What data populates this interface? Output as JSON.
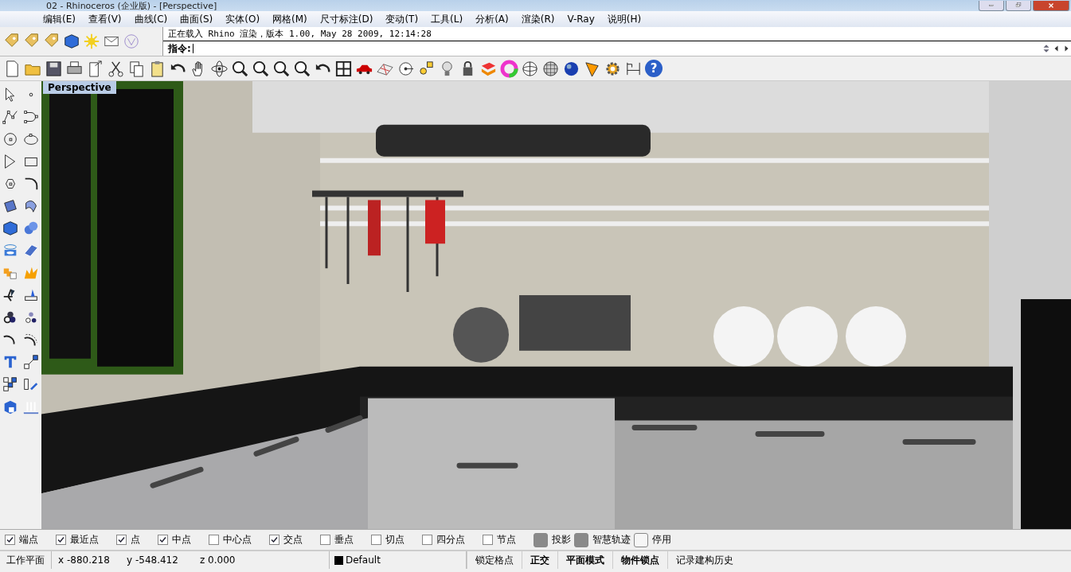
{
  "window": {
    "title": "02 - Rhinoceros (企业版) - [Perspective]"
  },
  "menu": [
    "编辑(E)",
    "查看(V)",
    "曲线(C)",
    "曲面(S)",
    "实体(O)",
    "网格(M)",
    "尺寸标注(D)",
    "变动(T)",
    "工具(L)",
    "分析(A)",
    "渲染(R)",
    "V-Ray",
    "说明(H)"
  ],
  "command": {
    "history": "正在载入 Rhino 渲染，版本 1.00, May 28 2009, 12:14:28",
    "prompt": "指令:"
  },
  "toolbar": {
    "help_glyph": "?"
  },
  "viewport": {
    "title": "Perspective"
  },
  "osnaps": [
    {
      "label": "端点",
      "kind": "checkbox",
      "checked": true
    },
    {
      "label": "最近点",
      "kind": "checkbox",
      "checked": true
    },
    {
      "label": "点",
      "kind": "checkbox",
      "checked": true
    },
    {
      "label": "中点",
      "kind": "checkbox",
      "checked": true
    },
    {
      "label": "中心点",
      "kind": "checkbox",
      "checked": false
    },
    {
      "label": "交点",
      "kind": "checkbox",
      "checked": true
    },
    {
      "label": "垂点",
      "kind": "checkbox",
      "checked": false
    },
    {
      "label": "切点",
      "kind": "checkbox",
      "checked": false
    },
    {
      "label": "四分点",
      "kind": "checkbox",
      "checked": false
    },
    {
      "label": "节点",
      "kind": "checkbox",
      "checked": false
    },
    {
      "label": "投影",
      "kind": "toggle",
      "on": true
    },
    {
      "label": "智慧轨迹",
      "kind": "toggle",
      "on": true
    },
    {
      "label": "停用",
      "kind": "toggle",
      "on": false
    }
  ],
  "status_bar": {
    "cplane": "工作平面",
    "x": "x -880.218",
    "y": "y -548.412",
    "z": "z 0.000",
    "layer": "Default",
    "toggles": [
      {
        "label": "锁定格点",
        "on": false
      },
      {
        "label": "正交",
        "on": true
      },
      {
        "label": "平面模式",
        "on": true
      },
      {
        "label": "物件锁点",
        "on": true
      },
      {
        "label": "记录建构历史",
        "on": false
      }
    ]
  }
}
